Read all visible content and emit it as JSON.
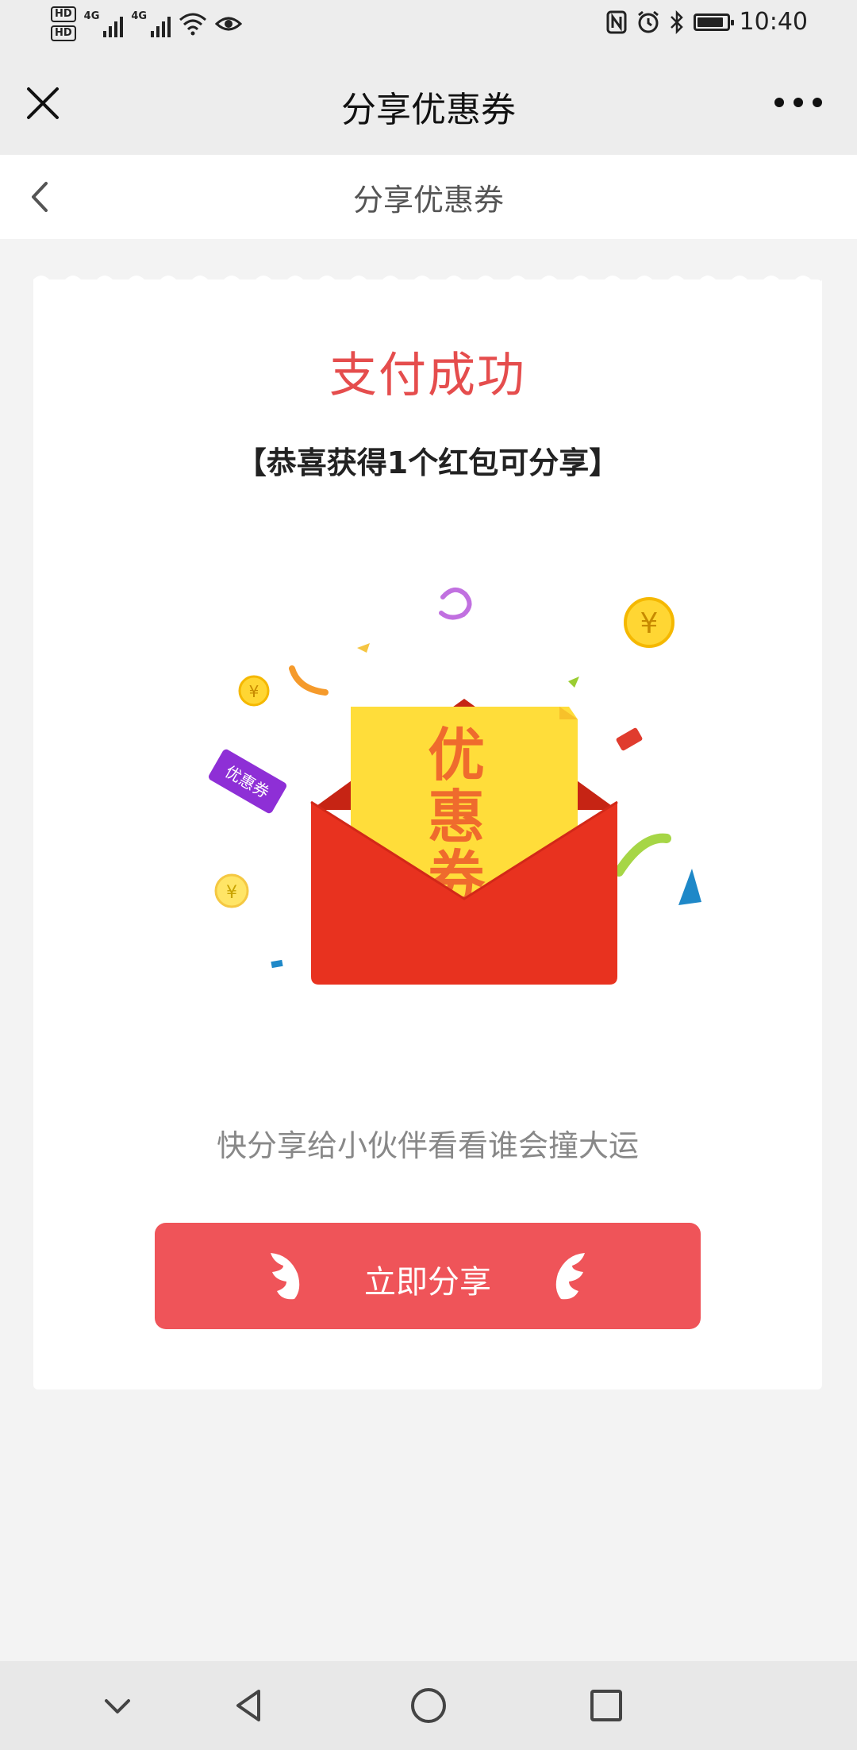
{
  "status_bar": {
    "time": "10:40",
    "hd1": "HD",
    "hd2": "HD",
    "net1": "4G",
    "net2": "4G"
  },
  "title_bar": {
    "title": "分享优惠券"
  },
  "page_header": {
    "title": "分享优惠券"
  },
  "card": {
    "title": "支付成功",
    "subtitle": "【恭喜获得1个红包可分享】",
    "coupon_text": "优惠券",
    "ribbon_text": "优惠券",
    "coin_symbol": "¥",
    "share_hint": "快分享给小伙伴看看谁会撞大运",
    "share_button": "立即分享"
  },
  "colors": {
    "accent": "#ef5459",
    "title_red": "#e54d4d",
    "envelope": "#e8321f",
    "coupon": "#ffd933"
  }
}
